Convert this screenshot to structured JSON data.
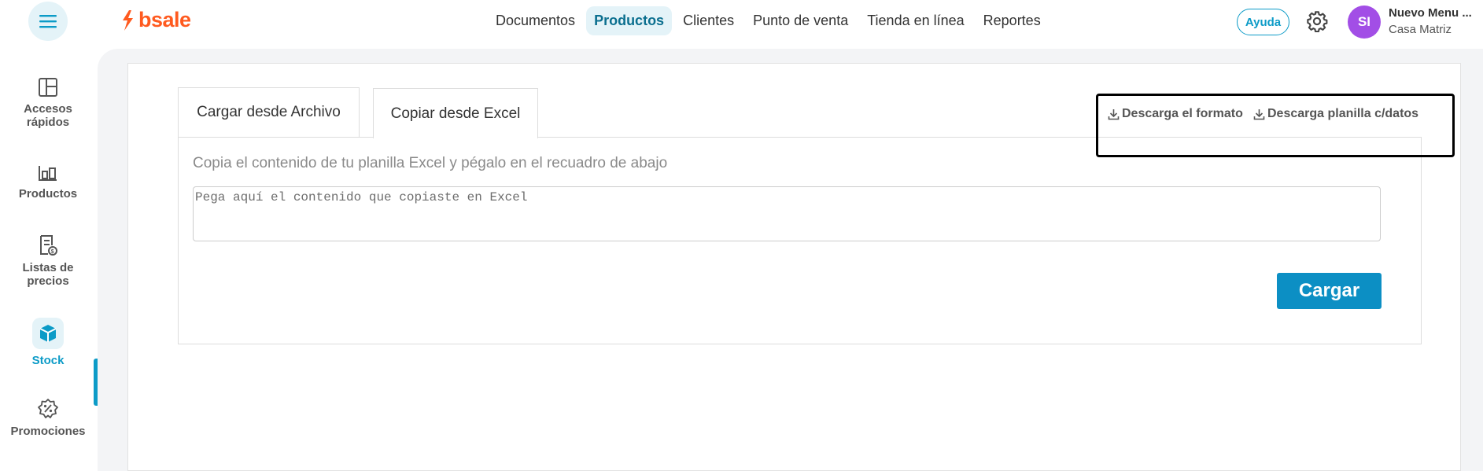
{
  "header": {
    "logo_text": "bsale",
    "nav": [
      "Documentos",
      "Productos",
      "Clientes",
      "Punto de venta",
      "Tienda en línea",
      "Reportes"
    ],
    "active_nav": "Productos",
    "help_label": "Ayuda",
    "user": {
      "initials": "SI",
      "name": "Nuevo Menu ...",
      "branch": "Casa Matriz"
    }
  },
  "sidebar": {
    "items": [
      {
        "label": "Accesos rápidos",
        "icon": "layout-icon"
      },
      {
        "label": "Productos",
        "icon": "products-icon"
      },
      {
        "label": "Listas de precios",
        "icon": "price-list-icon"
      },
      {
        "label": "Stock",
        "icon": "box-icon",
        "active": true
      },
      {
        "label": "Promociones",
        "icon": "promo-icon"
      }
    ]
  },
  "main": {
    "tabs": [
      {
        "label": "Cargar desde Archivo"
      },
      {
        "label": "Copiar desde Excel",
        "active": true
      }
    ],
    "instruction": "Copia el contenido de tu planilla Excel y pégalo en el recuadro de abajo",
    "textarea_placeholder": "Pega aquí el contenido que copiaste en Excel",
    "load_button": "Cargar",
    "download_format": "Descarga el formato",
    "download_with_data": "Descarga planilla c/datos"
  },
  "colors": {
    "accent": "#0c9bc7",
    "brand": "#ff5a1f",
    "avatar": "#a24ee6",
    "button": "#0c8fc4"
  }
}
